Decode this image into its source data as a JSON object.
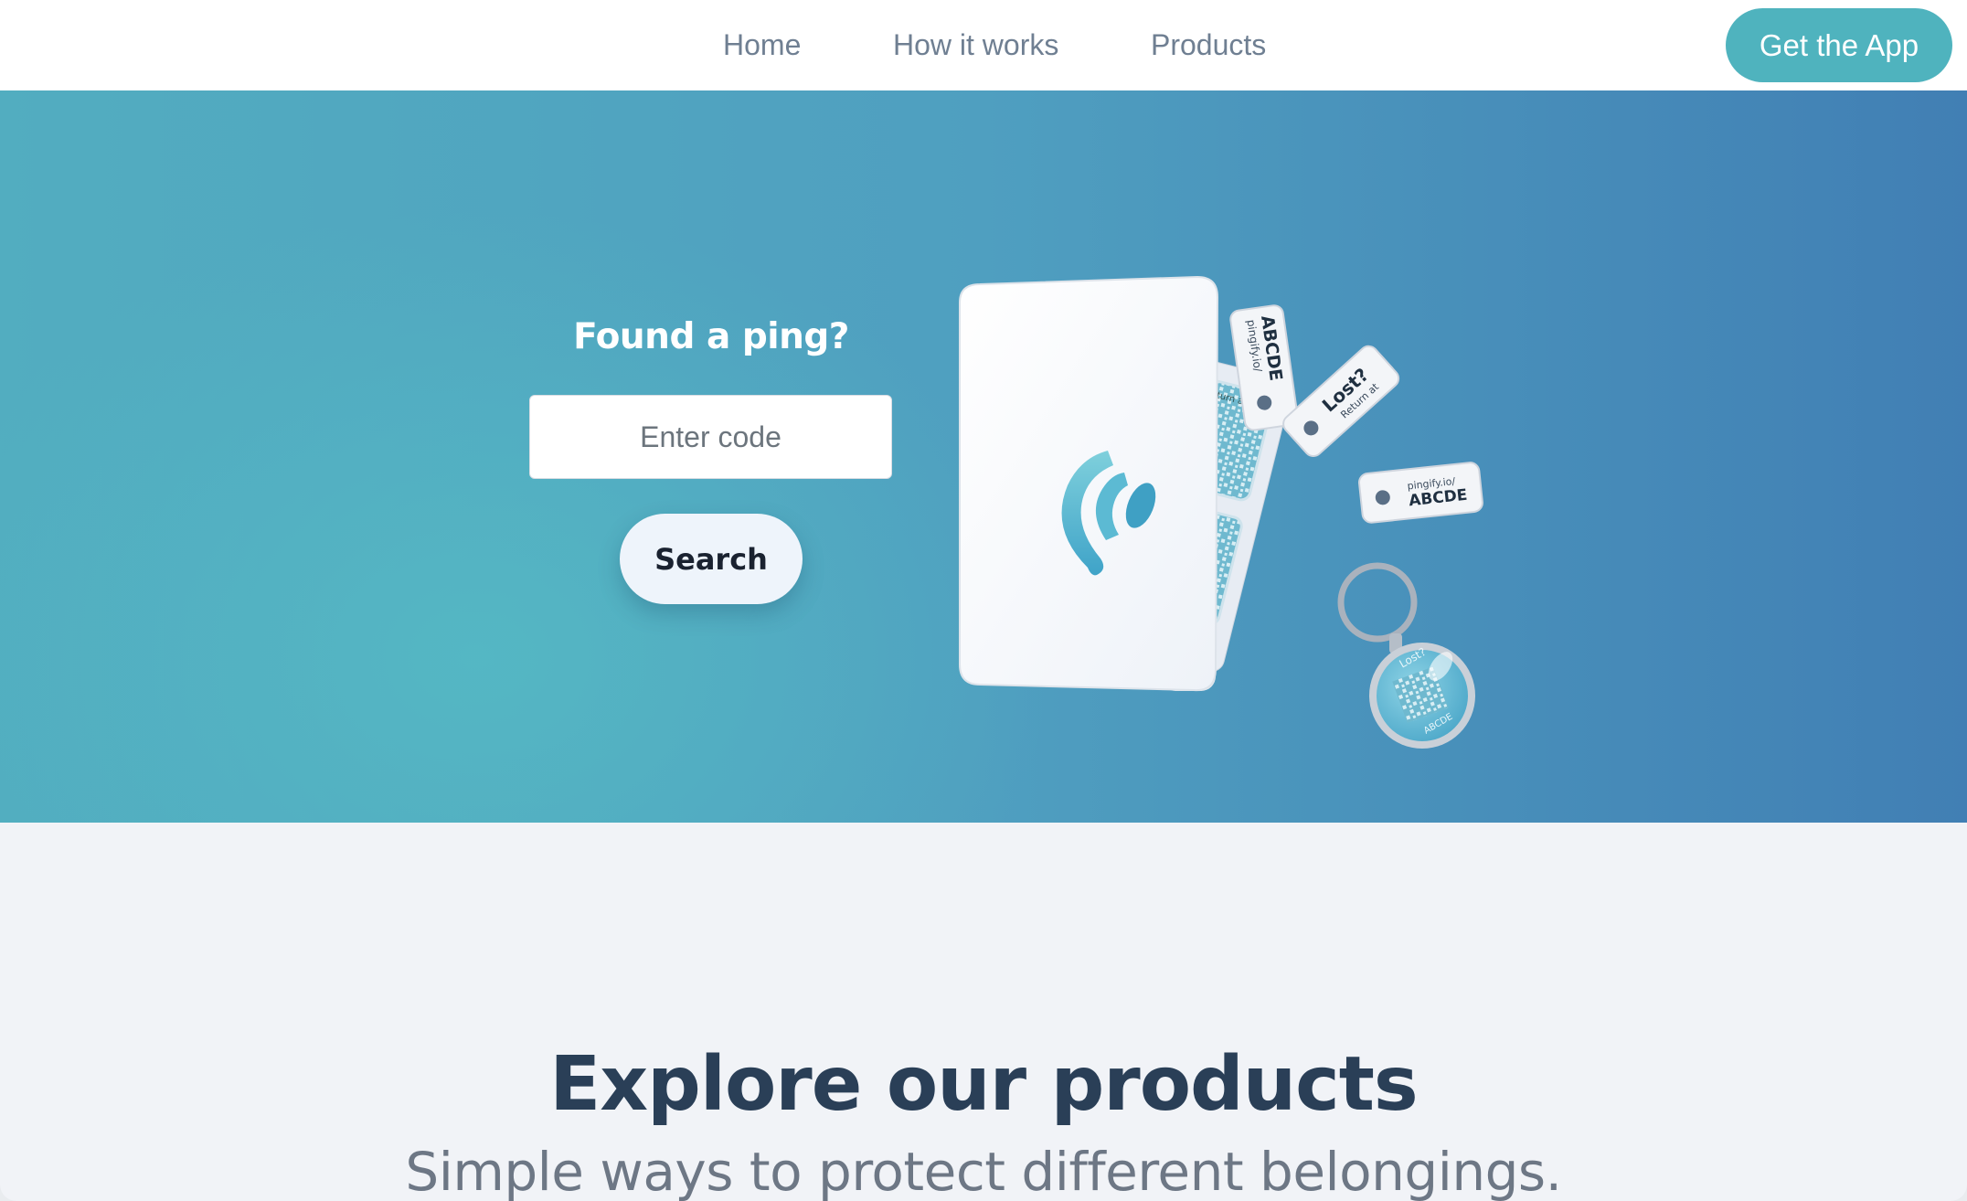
{
  "nav": {
    "links": [
      "Home",
      "How it works",
      "Products"
    ],
    "cta_label": "Get the App"
  },
  "hero": {
    "title": "Found a ping?",
    "input_placeholder": "Enter code",
    "search_label": "Search",
    "product_tags": {
      "tag1_url": "pingify.io/",
      "tag1_code": "ABCDE",
      "tag2_title": "Lost?",
      "tag2_sub": "Return at",
      "tag3_url": "pingify.io/",
      "tag3_code": "ABCDE",
      "sticker_text": "Lost? Return at",
      "keyring_title": "Lost?",
      "keyring_code": "ABCDE"
    }
  },
  "explore": {
    "title": "Explore our products",
    "subtitle": "Simple ways to protect different belongings."
  },
  "colors": {
    "accent": "#4fb3be",
    "hero_start": "#52adc0",
    "hero_end": "#417fb4",
    "heading": "#2a3f57"
  }
}
